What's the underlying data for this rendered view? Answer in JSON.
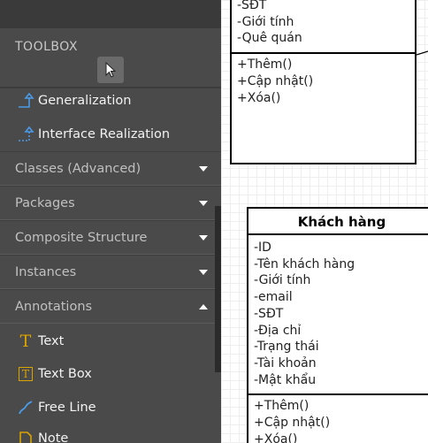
{
  "toolbox": {
    "title": "TOOLBOX",
    "pointer_icon": "cursor-arrow-icon",
    "items_top": [
      {
        "label": "Generalization",
        "icon": "generalization-icon"
      },
      {
        "label": "Interface Realization",
        "icon": "interface-realization-icon"
      }
    ],
    "categories": [
      {
        "label": "Classes (Advanced)",
        "expanded": false
      },
      {
        "label": "Packages",
        "expanded": false
      },
      {
        "label": "Composite Structure",
        "expanded": false
      },
      {
        "label": "Instances",
        "expanded": false
      },
      {
        "label": "Annotations",
        "expanded": true
      }
    ],
    "annotation_items": [
      {
        "label": "Text",
        "icon": "text-icon"
      },
      {
        "label": "Text Box",
        "icon": "text-box-icon"
      },
      {
        "label": "Free Line",
        "icon": "free-line-icon"
      },
      {
        "label": "Note",
        "icon": "note-icon"
      }
    ],
    "colors": {
      "panel": "#4a4a4a",
      "accent_blue": "#4a9be8",
      "accent_gold": "#d9a300"
    }
  },
  "canvas": {
    "class_top": {
      "attributes": [
        "-SĐT",
        "-Giới tính",
        "-Quê quán"
      ],
      "methods": [
        "+Thêm()",
        "+Cập nhật()",
        "+Xóa()"
      ]
    },
    "class_khach_hang": {
      "name": "Khách hàng",
      "attributes": [
        "-ID",
        "-Tên khách hàng",
        "-Giới tính",
        "-email",
        "-SĐT",
        "-Địa chỉ",
        "-Trạng thái",
        "-Tài khoản",
        "-Mật khẩu"
      ],
      "methods": [
        "+Thêm()",
        "+Cập nhật()",
        "+Xóa()"
      ]
    }
  }
}
